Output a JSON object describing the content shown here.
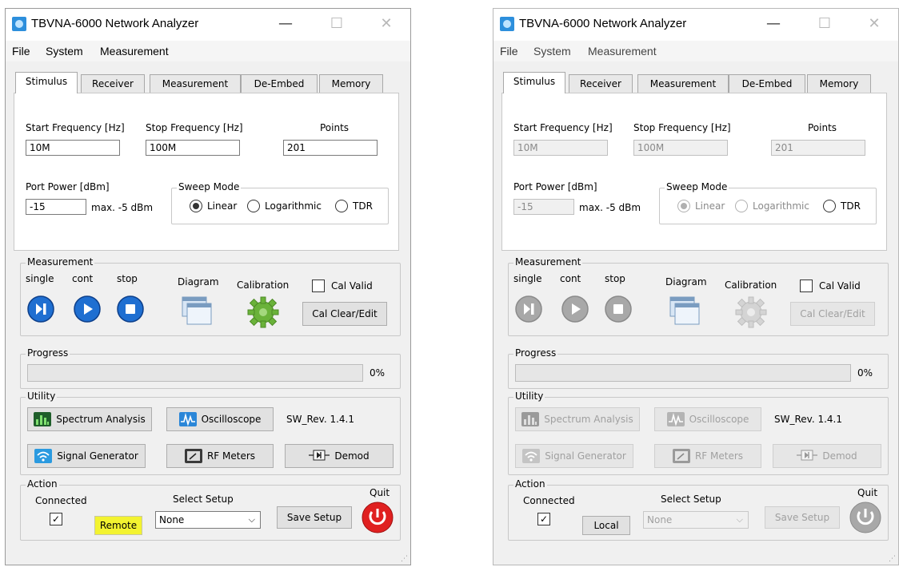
{
  "windows": {
    "left": {
      "title": "TBVNA-6000 Network Analyzer",
      "menu": [
        "File",
        "System",
        "Measurement"
      ],
      "tabs": [
        "Stimulus",
        "Receiver",
        "Measurement",
        "De-Embed",
        "Memory"
      ],
      "stimulus": {
        "start_label": "Start Frequency [Hz]",
        "start_value": "10M",
        "stop_label": "Stop Frequency [Hz]",
        "stop_value": "100M",
        "points_label": "Points",
        "points_value": "201",
        "power_label": "Port  Power [dBm]",
        "power_value": "-15",
        "power_max": "max. -5 dBm",
        "sweep_title": "Sweep Mode",
        "sweep_linear": "Linear",
        "sweep_log": "Logarithmic",
        "sweep_tdr": "TDR",
        "sweep_selected": "Linear"
      },
      "measurement": {
        "title": "Measurement",
        "single": "single",
        "cont": "cont",
        "stop": "stop",
        "diagram": "Diagram",
        "calibration": "Calibration",
        "cal_valid": "Cal Valid",
        "cal_clear": "Cal Clear/Edit"
      },
      "progress": {
        "title": "Progress",
        "percent": "0%",
        "fraction": 0
      },
      "utility": {
        "title": "Utility",
        "spectrum": "Spectrum Analysis",
        "oscilloscope": "Oscilloscope",
        "signal_gen": "Signal Generator",
        "rf_meters": "RF Meters",
        "demod": "Demod",
        "sw_rev": "SW_Rev. 1.4.1"
      },
      "action": {
        "title": "Action",
        "connected": "Connected",
        "connected_check": "✓",
        "mode_button": "Remote",
        "select_setup": "Select Setup",
        "setup_value": "None",
        "save_setup": "Save Setup",
        "quit": "Quit"
      }
    },
    "right": {
      "title": "TBVNA-6000 Network Analyzer",
      "menu": [
        "File",
        "System",
        "Measurement"
      ],
      "tabs": [
        "Stimulus",
        "Receiver",
        "Measurement",
        "De-Embed",
        "Memory"
      ],
      "stimulus": {
        "start_label": "Start Frequency [Hz]",
        "start_value": "10M",
        "stop_label": "Stop Frequency [Hz]",
        "stop_value": "100M",
        "points_label": "Points",
        "points_value": "201",
        "power_label": "Port  Power [dBm]",
        "power_value": "-15",
        "power_max": "max. -5 dBm",
        "sweep_title": "Sweep Mode",
        "sweep_linear": "Linear",
        "sweep_log": "Logarithmic",
        "sweep_tdr": "TDR",
        "sweep_selected": "Linear"
      },
      "measurement": {
        "title": "Measurement",
        "single": "single",
        "cont": "cont",
        "stop": "stop",
        "diagram": "Diagram",
        "calibration": "Calibration",
        "cal_valid": "Cal Valid",
        "cal_clear": "Cal Clear/Edit"
      },
      "progress": {
        "title": "Progress",
        "percent": "0%",
        "fraction": 0
      },
      "utility": {
        "title": "Utility",
        "spectrum": "Spectrum Analysis",
        "oscilloscope": "Oscilloscope",
        "signal_gen": "Signal Generator",
        "rf_meters": "RF Meters",
        "demod": "Demod",
        "sw_rev": "SW_Rev. 1.4.1"
      },
      "action": {
        "title": "Action",
        "connected": "Connected",
        "connected_check": "✓",
        "mode_button": "Local",
        "select_setup": "Select Setup",
        "setup_value": "None",
        "save_setup": "Save Setup",
        "quit": "Quit"
      }
    }
  },
  "icons": {
    "title_controls": [
      "minimize-icon",
      "maximize-icon",
      "close-icon"
    ],
    "minimize_glyph": "—",
    "maximize_glyph": "☐",
    "close_glyph": "✕",
    "chevron_glyph": "⌵",
    "resize_glyph": "⋰"
  },
  "colors": {
    "accent_blue": "#1f6fd1",
    "gear_green": "#6ab23a",
    "quit_red": "#e02020",
    "highlight_yellow": "#f3f330",
    "disabled_gray": "#a8a8a8"
  }
}
